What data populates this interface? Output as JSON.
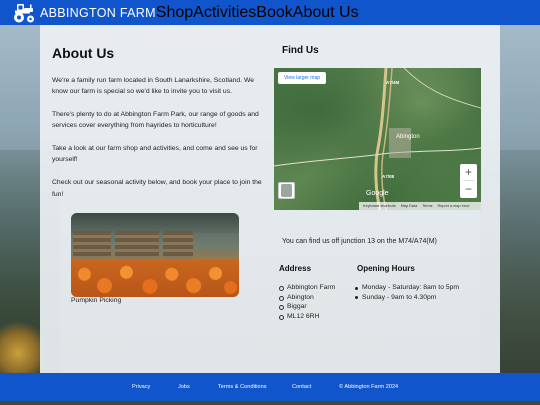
{
  "header": {
    "brand": "ABBINGTON  FARM",
    "logo_icon": "tractor-icon",
    "nav": [
      "Shop",
      "Activities",
      "Book",
      "About Us"
    ]
  },
  "about": {
    "title": "About Us",
    "paragraphs": [
      "We're a family run farm located in South Lanarkshire, Scotland. We know our farm is special so we'd like to invite you to visit us.",
      "There's plenty to do at Abbington Farm Park, our range of goods and services cover everything from hayrides to horticulture!",
      "Take a look at our farm shop and activities, and come and see us for yourself!",
      "Check out our seasonal activity below, and book your place to join the fun!"
    ],
    "photo_caption": "Pumpkin Picking"
  },
  "find_us": {
    "title": "Find Us",
    "map": {
      "larger_map_button": "View larger map",
      "zoom_in": "+",
      "zoom_out": "−",
      "provider": "Google",
      "road_labels": [
        "A7/4M",
        "A7/08"
      ],
      "town_label": "Abington",
      "footer_links": [
        "Keyboard shortcuts",
        "Map Data",
        "Terms",
        "Report a map error"
      ]
    },
    "directions": "You can find us off junction 13 on the M74/A74(M)",
    "address_title": "Address",
    "address_lines": [
      "Abbington Farm",
      "Abington",
      "Biggar",
      "ML12 6RH"
    ],
    "hours_title": "Opening Hours",
    "hours": [
      "Monday - Saturday: 8am to 5pm",
      "Sunday - 9am to 4.30pm"
    ]
  },
  "footer": {
    "links": [
      "Privacy",
      "Jobs",
      "Terms & Conditions",
      "Contact"
    ],
    "copyright": "© Abbington Farm 2024"
  },
  "colors": {
    "brand_blue": "#1155cc",
    "panel": "#eceff3"
  }
}
